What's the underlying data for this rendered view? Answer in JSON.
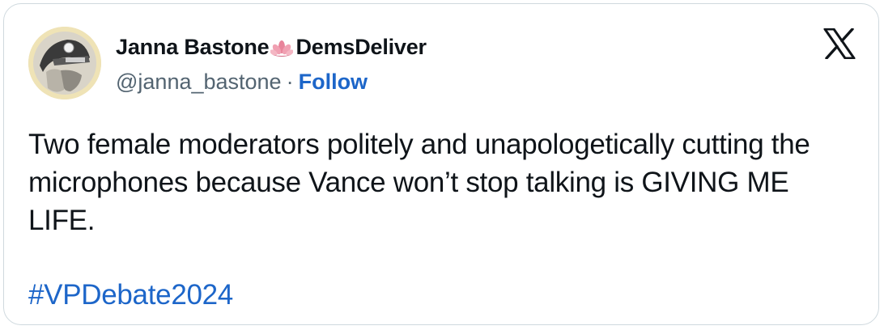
{
  "author": {
    "display_name": "Janna Bastone",
    "display_name_suffix": "DemsDeliver",
    "handle": "@janna_bastone",
    "separator": "·",
    "follow_label": "Follow",
    "avatar_icon": "avatar-photo"
  },
  "tweet": {
    "text": "Two female moderators politely and unapologetically cutting the microphones because Vance won’t stop talking is GIVING ME LIFE.",
    "hashtag": "#VPDebate2024"
  },
  "icons": {
    "brand": "x-logo-icon",
    "name_emoji": "lotus-icon"
  },
  "colors": {
    "link": "#1d66c9",
    "secondary_text": "#536471",
    "primary_text": "#0f1419",
    "border": "#cfd9de",
    "lotus": "#e8839a"
  }
}
